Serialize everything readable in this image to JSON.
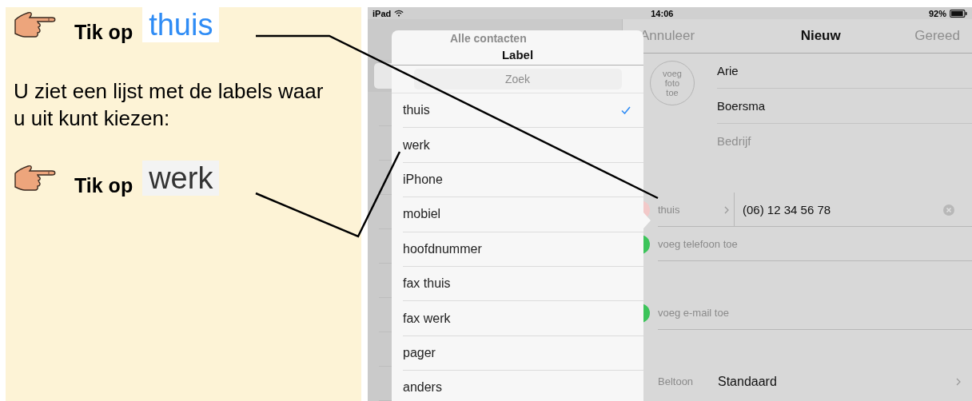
{
  "instructions": [
    {
      "kind": "tap",
      "prefix": "Tik op",
      "target": "thuis",
      "color": "#2f8cf5"
    },
    {
      "kind": "text",
      "text": "U ziet een lijst met de labels waar u uit kunt kiezen:"
    },
    {
      "kind": "tap",
      "prefix": "Tik op",
      "target": "werk",
      "color": "#333333"
    }
  ],
  "status_bar": {
    "device": "iPad",
    "time": "14:06",
    "battery": "92%"
  },
  "master": {
    "title": "Alle contacten",
    "search_placeholder": "Zoek"
  },
  "popover": {
    "title": "Label",
    "items": [
      {
        "label": "thuis",
        "checked": true
      },
      {
        "label": "werk",
        "checked": false
      },
      {
        "label": "iPhone",
        "checked": false
      },
      {
        "label": "mobiel",
        "checked": false
      },
      {
        "label": "hoofdnummer",
        "checked": false
      },
      {
        "label": "fax thuis",
        "checked": false
      },
      {
        "label": "fax werk",
        "checked": false
      },
      {
        "label": "pager",
        "checked": false
      },
      {
        "label": "anders",
        "checked": false
      }
    ]
  },
  "nav": {
    "cancel": "Annuleer",
    "title": "Nieuw",
    "done": "Gereed"
  },
  "photo_button": "voeg foto toe",
  "name_fields": [
    {
      "kind": "value",
      "text": "Arie"
    },
    {
      "kind": "value",
      "text": "Boersma"
    },
    {
      "kind": "placeholder",
      "text": "Bedrijf"
    }
  ],
  "phone": {
    "label": "thuis",
    "value": "(06) 12 34 56 78"
  },
  "add_rows": [
    "voeg telefoon toe",
    "voeg e-mail toe"
  ],
  "ringtone": {
    "label": "Beltoon",
    "value": "Standaard"
  }
}
